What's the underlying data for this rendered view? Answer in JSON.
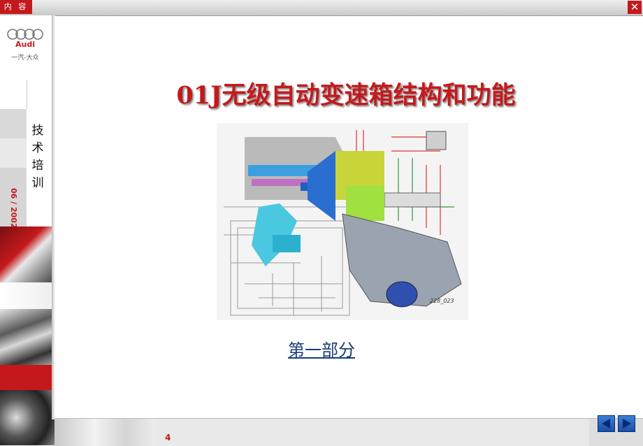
{
  "topbar": {
    "menu_label": "内 容",
    "close_label": "✕"
  },
  "sidebar": {
    "logo_brand": "Audi",
    "logo_sub": "一汽-大众",
    "category": "技术培训",
    "date": "06 / 2002"
  },
  "main": {
    "title": "01J无级自动变速箱结构和功能",
    "diagram_caption": "228_023",
    "part_link": "第一部分"
  },
  "footer": {
    "page_number": "4"
  },
  "colors": {
    "accent": "#c4191c",
    "link": "#1a3c7a",
    "nav_blue": "#2a62c4"
  },
  "icons": {
    "prev": "arrow-left-icon",
    "next": "arrow-right-icon",
    "close": "close-icon",
    "logo": "audi-rings-icon"
  }
}
